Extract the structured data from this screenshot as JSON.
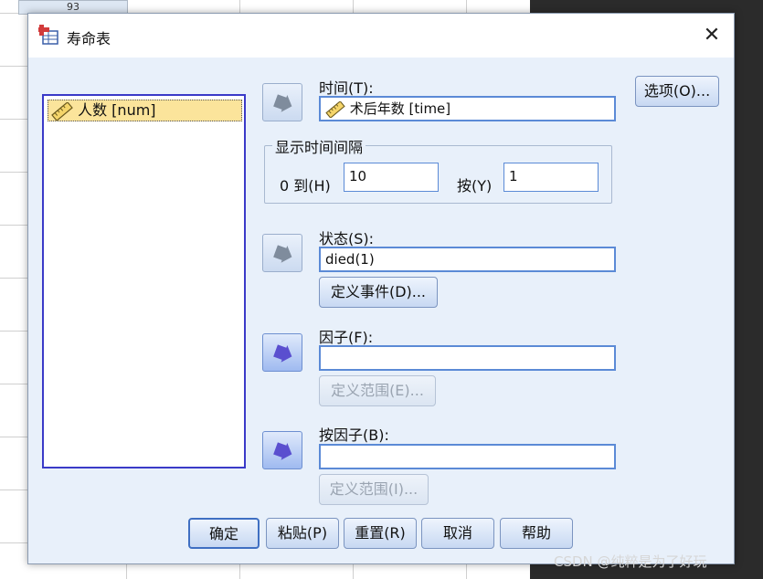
{
  "background": {
    "cell_value": "93"
  },
  "window": {
    "title": "寿命表",
    "close_icon": "close-icon"
  },
  "source_list": {
    "items": [
      {
        "label": "人数 [num]",
        "icon": "ruler-scale-icon"
      }
    ]
  },
  "time": {
    "label": "时间(T):",
    "value": "术后年数 [time]",
    "icon": "ruler-scale-icon"
  },
  "options_button": "选项(O)...",
  "interval": {
    "group_title": "显示时间间隔",
    "from_label": "0 到(H)",
    "from_value": "10",
    "by_label": "按(Y)",
    "by_value": "1"
  },
  "status": {
    "label": "状态(S):",
    "value": "died(1)",
    "define_event_button": "定义事件(D)..."
  },
  "factor": {
    "label": "因子(F):",
    "value": "",
    "define_range_button": "定义范围(E)..."
  },
  "by_factor": {
    "label": "按因子(B):",
    "value": "",
    "define_range_button": "定义范围(I)..."
  },
  "footer_buttons": {
    "ok": "确定",
    "paste": "粘贴(P)",
    "reset": "重置(R)",
    "cancel": "取消",
    "help": "帮助"
  },
  "watermark": "CSDN @纯粹是为了好玩",
  "colors": {
    "dialog_bg": "#e8f0fa",
    "list_border": "#3a3ac8",
    "selected_item": "#fbe49b",
    "field_border": "#5b8ad6"
  }
}
